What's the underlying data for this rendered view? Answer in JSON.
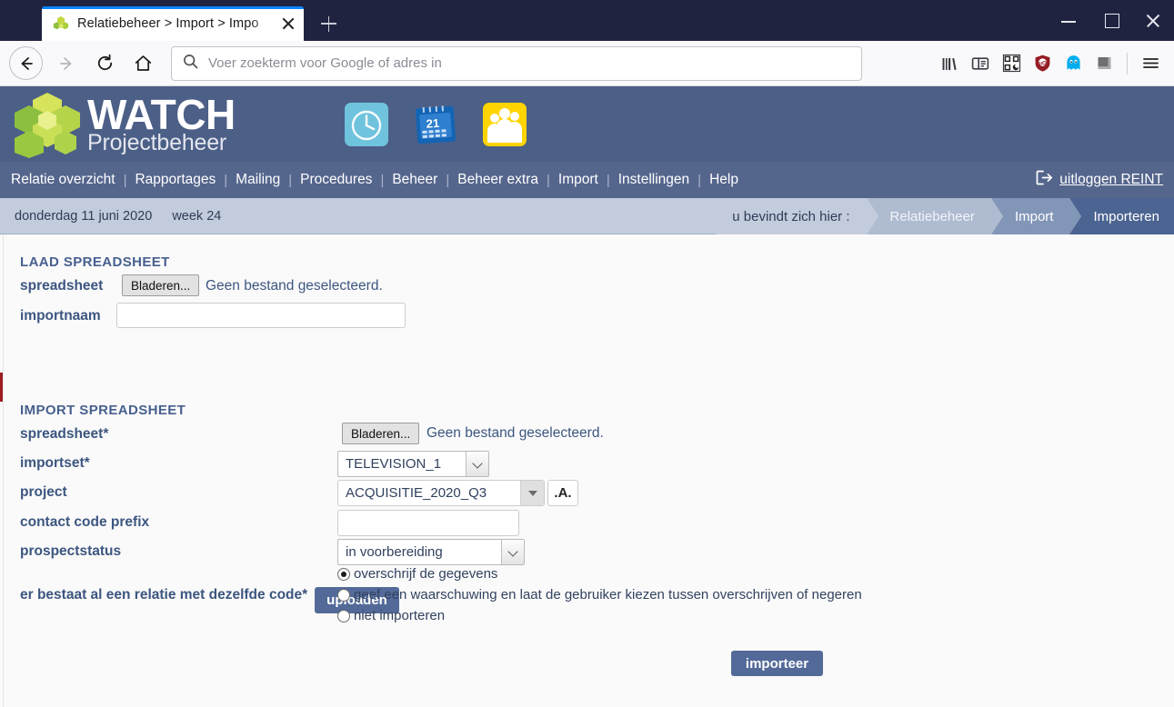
{
  "browser": {
    "tab": {
      "title": "Relatiebeheer > Import > Impo",
      "favicon": "watch-cluster-icon"
    },
    "newtab_label": "+",
    "window_controls": {
      "minimize": "minimize-icon",
      "maximize": "maximize-icon",
      "close": "close-icon"
    },
    "nav": {
      "back": "back-arrow-icon",
      "forward": "forward-arrow-icon",
      "reload": "reload-icon",
      "home": "home-icon"
    },
    "urlbar": {
      "placeholder": "Voer zoekterm voor Google of adres in",
      "value": "",
      "search_icon": "search-icon"
    },
    "toolbar_icons": [
      {
        "name": "library-icon"
      },
      {
        "name": "sidebar-icon"
      },
      {
        "name": "qr-reader-icon"
      },
      {
        "name": "ublock-origin-icon"
      },
      {
        "name": "ghostery-icon"
      },
      {
        "name": "extension-square-icon"
      },
      {
        "name": "hamburger-menu-icon"
      }
    ]
  },
  "app": {
    "logo": {
      "title": "WATCH",
      "subtitle": "Projectbeheer"
    },
    "header_icons": [
      {
        "name": "clock-icon"
      },
      {
        "name": "calendar-icon",
        "label": "21"
      },
      {
        "name": "people-icon"
      }
    ],
    "menu": [
      {
        "label": "Relatie overzicht"
      },
      {
        "label": "Rapportages"
      },
      {
        "label": "Mailing"
      },
      {
        "label": "Procedures"
      },
      {
        "label": "Beheer"
      },
      {
        "label": "Beheer extra"
      },
      {
        "label": "Import"
      },
      {
        "label": "Instellingen"
      },
      {
        "label": "Help"
      }
    ],
    "menu_separator": "|",
    "logout": {
      "label": "uitloggen REINT",
      "icon": "logout-icon"
    },
    "statusbar": {
      "date": "donderdag 11 juni 2020",
      "week": "week 24"
    },
    "breadcrumb": {
      "prefix": "u bevindt zich hier :",
      "items": [
        {
          "label": "Relatiebeheer"
        },
        {
          "label": "Import"
        },
        {
          "label": "Importeren"
        }
      ]
    }
  },
  "form": {
    "load_section": {
      "title": "LAAD SPREADSHEET",
      "spreadsheet_label": "spreadsheet",
      "browse_button": "Bladeren...",
      "no_file_text": "Geen bestand geselecteerd.",
      "importnaam_label": "importnaam",
      "importnaam_value": "",
      "upload_button": "uploaden"
    },
    "import_section": {
      "title": "IMPORT SPREADSHEET",
      "spreadsheet_label": "spreadsheet*",
      "browse_button": "Bladeren...",
      "no_file_text": "Geen bestand geselecteerd.",
      "importset_label": "importset*",
      "importset_value": "TELEVISION_1",
      "project_label": "project",
      "project_value": "ACQUISITIE_2020_Q3",
      "project_alpha_button": ".A.",
      "contact_prefix_label": "contact code prefix",
      "contact_prefix_value": "",
      "prospectstatus_label": "prospectstatus",
      "prospectstatus_value": "in voorbereiding",
      "duplicate_label": "er bestaat al een relatie met dezelfde code*",
      "duplicate_options": [
        {
          "label": "overschrijf de gegevens",
          "selected": true
        },
        {
          "label": "geef een waarschuwing en laat de gebruiker kiezen tussen overschrijven of negeren",
          "selected": false
        },
        {
          "label": "niet importeren",
          "selected": false
        }
      ],
      "import_button": "importeer"
    }
  },
  "colors": {
    "chrome_dark": "#202340",
    "app_header": "#4c5f87",
    "menu_bar": "#55668d",
    "crumb_bar": "#c3ccdc",
    "primary_button": "#536a99",
    "label_blue": "#3c5680",
    "accent_red": "#9b1c22"
  }
}
